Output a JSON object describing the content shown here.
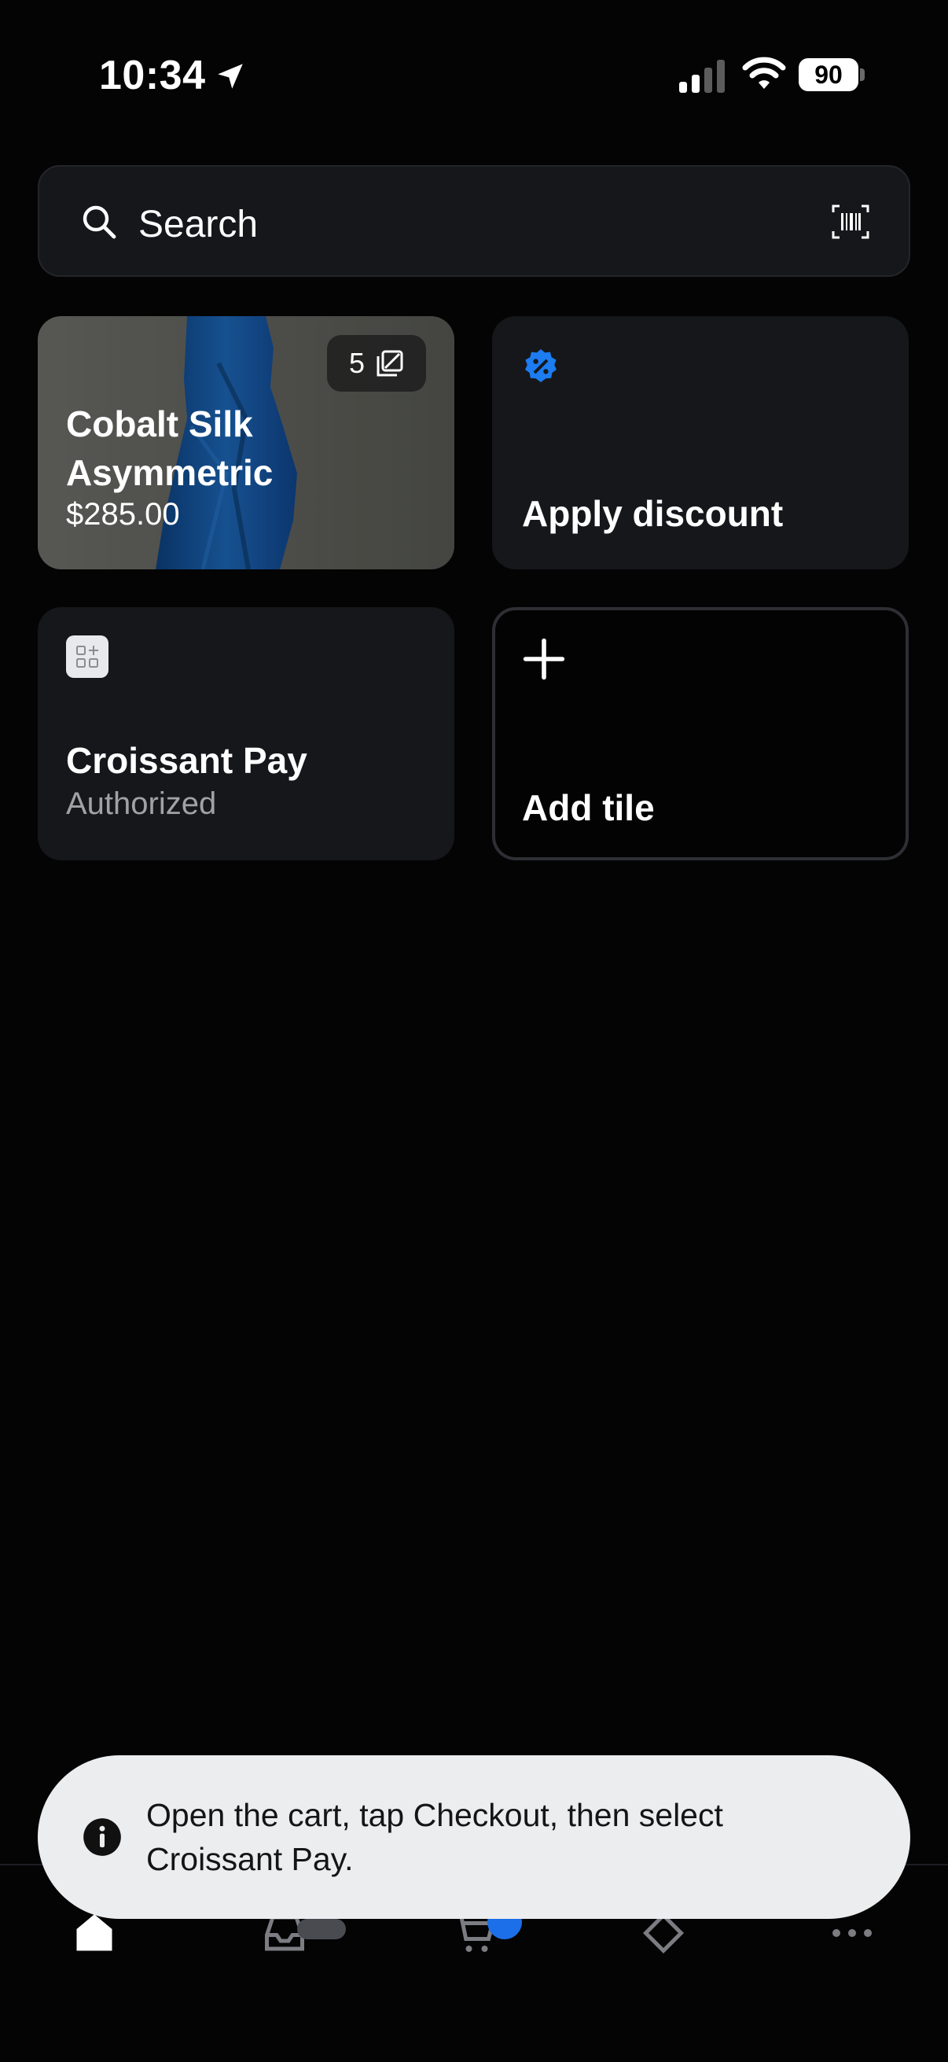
{
  "status_bar": {
    "time": "10:34",
    "battery": "90"
  },
  "search": {
    "placeholder": "Search"
  },
  "tiles": {
    "product": {
      "name": "Cobalt Silk Asymmetric",
      "price": "$285.00",
      "image_count": "5"
    },
    "discount": {
      "title": "Apply discount"
    },
    "payment": {
      "title": "Croissant Pay",
      "status": "Authorized"
    },
    "add": {
      "title": "Add tile"
    }
  },
  "toast": {
    "message": "Open the cart, tap Checkout, then select Croissant Pay."
  },
  "colors": {
    "background": "#040404",
    "tile": "#16171b",
    "accent_blue": "#1c6fe8",
    "toast_bg": "#ecedef"
  }
}
